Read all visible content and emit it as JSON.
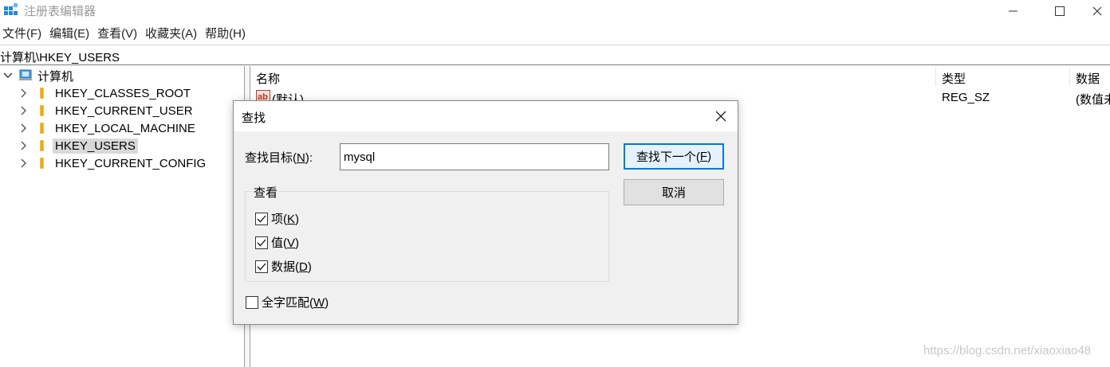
{
  "window": {
    "title": "注册表编辑器"
  },
  "menu": [
    {
      "label": "文件(F)"
    },
    {
      "label": "编辑(E)"
    },
    {
      "label": "查看(V)"
    },
    {
      "label": "收藏夹(A)"
    },
    {
      "label": "帮助(H)"
    }
  ],
  "address": "计算机\\HKEY_USERS",
  "tree": {
    "root": "计算机",
    "items": [
      {
        "label": "HKEY_CLASSES_ROOT"
      },
      {
        "label": "HKEY_CURRENT_USER"
      },
      {
        "label": "HKEY_LOCAL_MACHINE"
      },
      {
        "label": "HKEY_USERS",
        "selected": true
      },
      {
        "label": "HKEY_CURRENT_CONFIG"
      }
    ]
  },
  "list": {
    "columns": {
      "name": "名称",
      "type": "类型",
      "data": "数据"
    },
    "rows": [
      {
        "name": "(默认)",
        "type": "REG_SZ",
        "data": "(数值未"
      }
    ]
  },
  "find_dialog": {
    "title": "查找",
    "target_label_prefix": "查找目标(",
    "target_label_key": "N",
    "target_label_suffix": "):",
    "target_value": "mysql",
    "find_next_prefix": "查找下一个(",
    "find_next_key": "F",
    "find_next_suffix": ")",
    "cancel_label": "取消",
    "look_at_label": "查看",
    "options": [
      {
        "prefix": "项(",
        "key": "K",
        "suffix": ")",
        "checked": true
      },
      {
        "prefix": "值(",
        "key": "V",
        "suffix": ")",
        "checked": true
      },
      {
        "prefix": "数据(",
        "key": "D",
        "suffix": ")",
        "checked": true
      }
    ],
    "match_whole": {
      "prefix": "全字匹配(",
      "key": "W",
      "suffix": ")",
      "checked": false
    }
  },
  "watermark": "https://blog.csdn.net/xiaoxiao48",
  "colors": {
    "accent": "#0078d7",
    "folder": "#f5c242",
    "selection": "#d9d9d9"
  }
}
